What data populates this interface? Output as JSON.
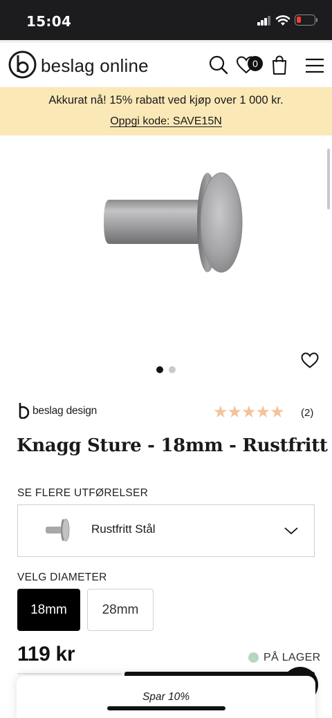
{
  "status_bar": {
    "time": "15:04"
  },
  "header": {
    "logo_text": "beslag online",
    "wishlist_count": "0",
    "icons": [
      "search-icon",
      "heart-icon",
      "bag-icon",
      "menu-icon"
    ]
  },
  "promo": {
    "text": "Akkurat nå! 15% rabatt ved kjøp over 1 000 kr.",
    "code_link": "Oppgi kode: SAVE15N"
  },
  "gallery": {
    "image_count": 2,
    "active_index": 0
  },
  "product": {
    "brand": "beslag design",
    "rating": 5,
    "rating_count": "(2)",
    "title": "Knagg Sture - 18mm - Rustfritt",
    "variants_label": "SE FLERE UTFØRELSER",
    "selected_variant": "Rustfritt Stål",
    "diameter_label": "VELG DIAMETER",
    "diameters": [
      {
        "label": "18mm",
        "selected": true
      },
      {
        "label": "28mm",
        "selected": false
      }
    ],
    "price": "119 kr",
    "stock": "PÅ LAGER"
  },
  "toast": {
    "text": "Spar 10%"
  },
  "colors": {
    "promo_bg": "#fbe8b7",
    "star": "#f2c39c",
    "stock_dot": "#b5d6bf",
    "status_bar_bg": "#1c1c1e"
  }
}
